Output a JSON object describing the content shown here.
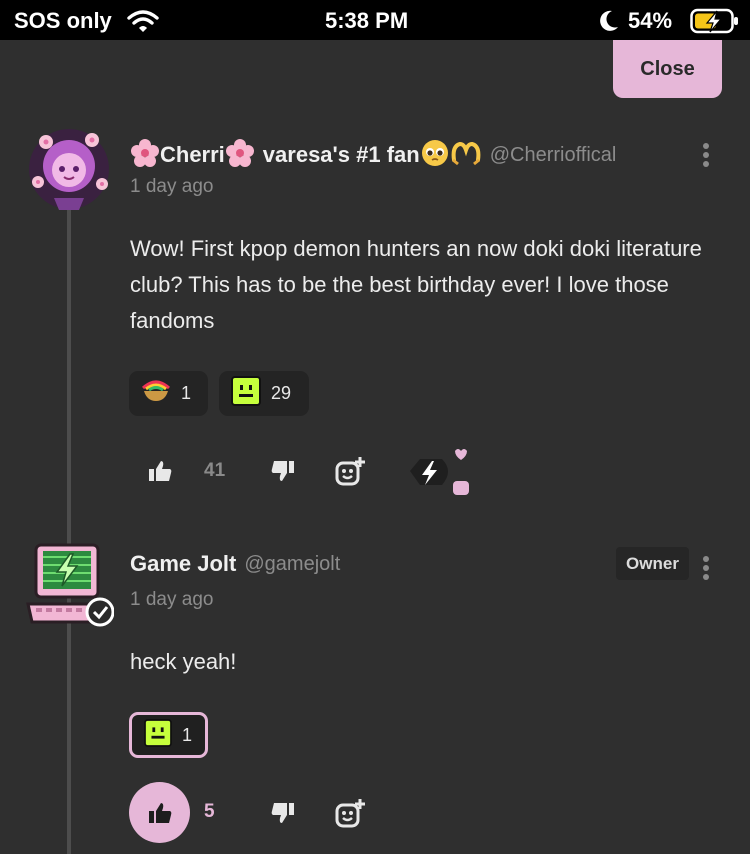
{
  "status_bar": {
    "carrier": "SOS only",
    "time": "5:38 PM",
    "battery": "54%"
  },
  "close_label": "Close",
  "comments": [
    {
      "display_name": "Cherri",
      "title_text": "varesa's #1 fan",
      "username": "@Cherrioffical",
      "time": "1 day ago",
      "text": "Wow! First kpop demon hunters an now doki doki literature club? This has to be the best birthday ever! I love those fandoms",
      "reactions": [
        {
          "icon": "rainbow-bowl-sticker-icon",
          "count": "1"
        },
        {
          "icon": "green-smiley-sticker-icon",
          "count": "29"
        }
      ],
      "likes": "41"
    },
    {
      "display_name": "Game Jolt",
      "username": "@gamejolt",
      "badge": "Owner",
      "time": "1 day ago",
      "text": "heck yeah!",
      "reactions": [
        {
          "icon": "green-smiley-sticker-icon",
          "count": "1"
        }
      ],
      "likes": "5"
    }
  ],
  "colors": {
    "accent": "#e6b7d8",
    "background": "#2f2f2f",
    "muted": "#8c8c8c"
  }
}
